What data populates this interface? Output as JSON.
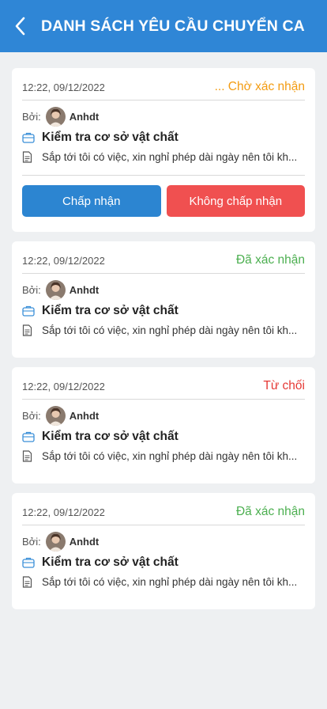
{
  "header": {
    "title": "DANH SÁCH YÊU CẦU CHUYỂN CA",
    "back_icon": "chevron-left-icon"
  },
  "colors": {
    "primary": "#2f86d6",
    "pending": "#f39c12",
    "confirmed": "#4caf50",
    "rejected": "#e53935",
    "reject_button": "#f05050"
  },
  "requests": [
    {
      "time": "12:22, 09/12/2022",
      "status": "... Chờ xác nhận",
      "by_label": "Bởi:",
      "author": "Anhdt",
      "title": "Kiểm tra cơ sở vật chất",
      "description": "Sắp tới tôi có việc, xin nghỉ phép dài ngày nên tôi kh...",
      "accept_label": "Chấp nhận",
      "reject_label": "Không chấp nhận"
    },
    {
      "time": "12:22, 09/12/2022",
      "status": "Đã xác nhận",
      "by_label": "Bởi:",
      "author": "Anhdt",
      "title": "Kiểm tra cơ sở vật chất",
      "description": "Sắp tới tôi có việc, xin nghỉ phép dài ngày nên tôi kh..."
    },
    {
      "time": "12:22, 09/12/2022",
      "status": "Từ chối",
      "by_label": "Bởi:",
      "author": "Anhdt",
      "title": "Kiểm tra cơ sở vật chất",
      "description": "Sắp tới tôi có việc, xin nghỉ phép dài ngày nên tôi kh..."
    },
    {
      "time": "12:22, 09/12/2022",
      "status": "Đã xác nhận",
      "by_label": "Bởi:",
      "author": "Anhdt",
      "title": "Kiểm tra cơ sở vật chất",
      "description": "Sắp tới tôi có việc, xin nghỉ phép dài ngày nên tôi kh..."
    }
  ]
}
